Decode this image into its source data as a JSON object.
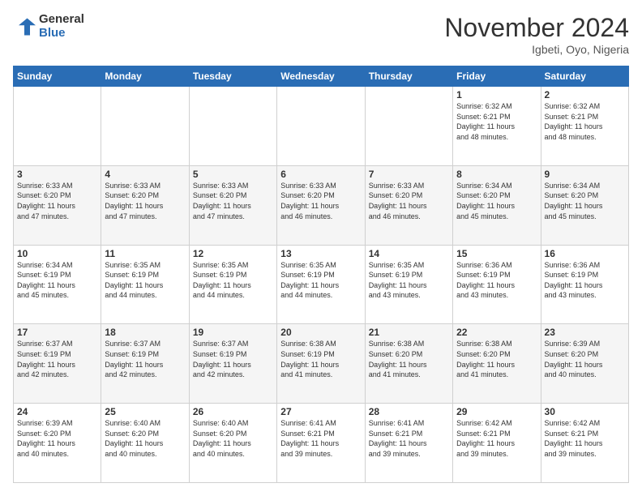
{
  "header": {
    "logo_general": "General",
    "logo_blue": "Blue",
    "title": "November 2024",
    "location": "Igbeti, Oyo, Nigeria"
  },
  "days_of_week": [
    "Sunday",
    "Monday",
    "Tuesday",
    "Wednesday",
    "Thursday",
    "Friday",
    "Saturday"
  ],
  "weeks": [
    [
      {
        "day": "",
        "info": ""
      },
      {
        "day": "",
        "info": ""
      },
      {
        "day": "",
        "info": ""
      },
      {
        "day": "",
        "info": ""
      },
      {
        "day": "",
        "info": ""
      },
      {
        "day": "1",
        "info": "Sunrise: 6:32 AM\nSunset: 6:21 PM\nDaylight: 11 hours\nand 48 minutes."
      },
      {
        "day": "2",
        "info": "Sunrise: 6:32 AM\nSunset: 6:21 PM\nDaylight: 11 hours\nand 48 minutes."
      }
    ],
    [
      {
        "day": "3",
        "info": "Sunrise: 6:33 AM\nSunset: 6:20 PM\nDaylight: 11 hours\nand 47 minutes."
      },
      {
        "day": "4",
        "info": "Sunrise: 6:33 AM\nSunset: 6:20 PM\nDaylight: 11 hours\nand 47 minutes."
      },
      {
        "day": "5",
        "info": "Sunrise: 6:33 AM\nSunset: 6:20 PM\nDaylight: 11 hours\nand 47 minutes."
      },
      {
        "day": "6",
        "info": "Sunrise: 6:33 AM\nSunset: 6:20 PM\nDaylight: 11 hours\nand 46 minutes."
      },
      {
        "day": "7",
        "info": "Sunrise: 6:33 AM\nSunset: 6:20 PM\nDaylight: 11 hours\nand 46 minutes."
      },
      {
        "day": "8",
        "info": "Sunrise: 6:34 AM\nSunset: 6:20 PM\nDaylight: 11 hours\nand 45 minutes."
      },
      {
        "day": "9",
        "info": "Sunrise: 6:34 AM\nSunset: 6:20 PM\nDaylight: 11 hours\nand 45 minutes."
      }
    ],
    [
      {
        "day": "10",
        "info": "Sunrise: 6:34 AM\nSunset: 6:19 PM\nDaylight: 11 hours\nand 45 minutes."
      },
      {
        "day": "11",
        "info": "Sunrise: 6:35 AM\nSunset: 6:19 PM\nDaylight: 11 hours\nand 44 minutes."
      },
      {
        "day": "12",
        "info": "Sunrise: 6:35 AM\nSunset: 6:19 PM\nDaylight: 11 hours\nand 44 minutes."
      },
      {
        "day": "13",
        "info": "Sunrise: 6:35 AM\nSunset: 6:19 PM\nDaylight: 11 hours\nand 44 minutes."
      },
      {
        "day": "14",
        "info": "Sunrise: 6:35 AM\nSunset: 6:19 PM\nDaylight: 11 hours\nand 43 minutes."
      },
      {
        "day": "15",
        "info": "Sunrise: 6:36 AM\nSunset: 6:19 PM\nDaylight: 11 hours\nand 43 minutes."
      },
      {
        "day": "16",
        "info": "Sunrise: 6:36 AM\nSunset: 6:19 PM\nDaylight: 11 hours\nand 43 minutes."
      }
    ],
    [
      {
        "day": "17",
        "info": "Sunrise: 6:37 AM\nSunset: 6:19 PM\nDaylight: 11 hours\nand 42 minutes."
      },
      {
        "day": "18",
        "info": "Sunrise: 6:37 AM\nSunset: 6:19 PM\nDaylight: 11 hours\nand 42 minutes."
      },
      {
        "day": "19",
        "info": "Sunrise: 6:37 AM\nSunset: 6:19 PM\nDaylight: 11 hours\nand 42 minutes."
      },
      {
        "day": "20",
        "info": "Sunrise: 6:38 AM\nSunset: 6:19 PM\nDaylight: 11 hours\nand 41 minutes."
      },
      {
        "day": "21",
        "info": "Sunrise: 6:38 AM\nSunset: 6:20 PM\nDaylight: 11 hours\nand 41 minutes."
      },
      {
        "day": "22",
        "info": "Sunrise: 6:38 AM\nSunset: 6:20 PM\nDaylight: 11 hours\nand 41 minutes."
      },
      {
        "day": "23",
        "info": "Sunrise: 6:39 AM\nSunset: 6:20 PM\nDaylight: 11 hours\nand 40 minutes."
      }
    ],
    [
      {
        "day": "24",
        "info": "Sunrise: 6:39 AM\nSunset: 6:20 PM\nDaylight: 11 hours\nand 40 minutes."
      },
      {
        "day": "25",
        "info": "Sunrise: 6:40 AM\nSunset: 6:20 PM\nDaylight: 11 hours\nand 40 minutes."
      },
      {
        "day": "26",
        "info": "Sunrise: 6:40 AM\nSunset: 6:20 PM\nDaylight: 11 hours\nand 40 minutes."
      },
      {
        "day": "27",
        "info": "Sunrise: 6:41 AM\nSunset: 6:21 PM\nDaylight: 11 hours\nand 39 minutes."
      },
      {
        "day": "28",
        "info": "Sunrise: 6:41 AM\nSunset: 6:21 PM\nDaylight: 11 hours\nand 39 minutes."
      },
      {
        "day": "29",
        "info": "Sunrise: 6:42 AM\nSunset: 6:21 PM\nDaylight: 11 hours\nand 39 minutes."
      },
      {
        "day": "30",
        "info": "Sunrise: 6:42 AM\nSunset: 6:21 PM\nDaylight: 11 hours\nand 39 minutes."
      }
    ]
  ]
}
